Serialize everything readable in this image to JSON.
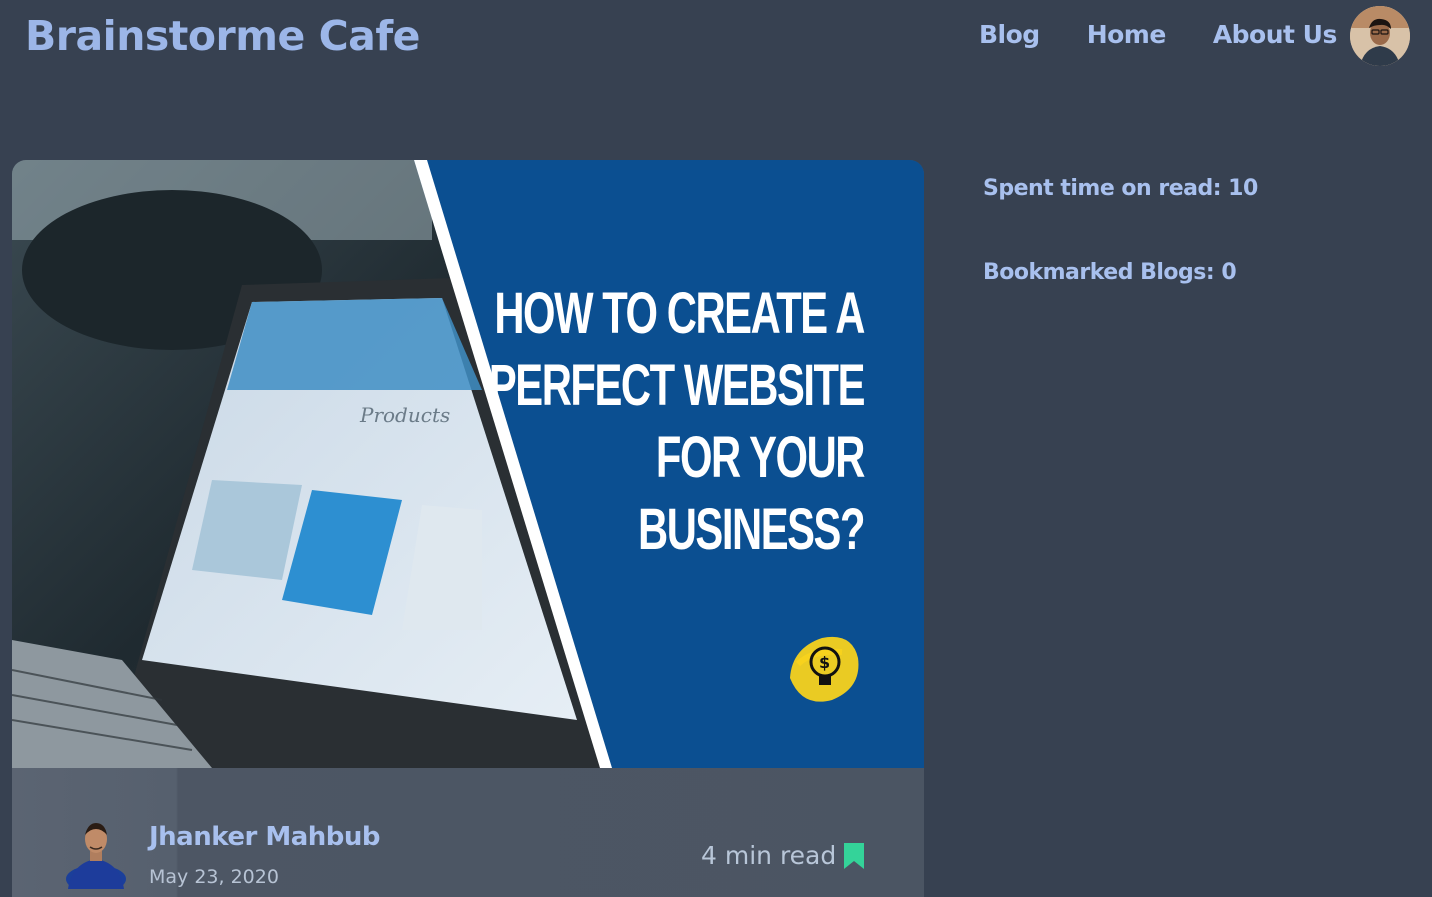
{
  "header": {
    "brand": "Brainstorme Cafe",
    "nav": [
      {
        "label": "Blog"
      },
      {
        "label": "Home"
      },
      {
        "label": "About Us"
      }
    ],
    "profile_icon": "user-avatar"
  },
  "post": {
    "cover_title_lines": [
      "HOW TO CREATE A",
      "PERFECT WEBSITE",
      "FOR YOUR",
      "BUSINESS?"
    ],
    "cover_screen_text": "Products",
    "author": {
      "name": "Jhanker Mahbub",
      "date": "May 23, 2020"
    },
    "read_time": "4 min read",
    "bookmark_icon": "bookmark-icon"
  },
  "sidebar": {
    "spent_time": "Spent time on read: 10",
    "bookmarked": "Bookmarked Blogs: 0"
  },
  "colors": {
    "background": "#374151",
    "card_meta": "#4b5563",
    "accent_text": "#a8c0ee",
    "cover_blue": "#0b4f91",
    "bookmark_green": "#34d399",
    "bulb_yellow": "#f7d21d"
  }
}
